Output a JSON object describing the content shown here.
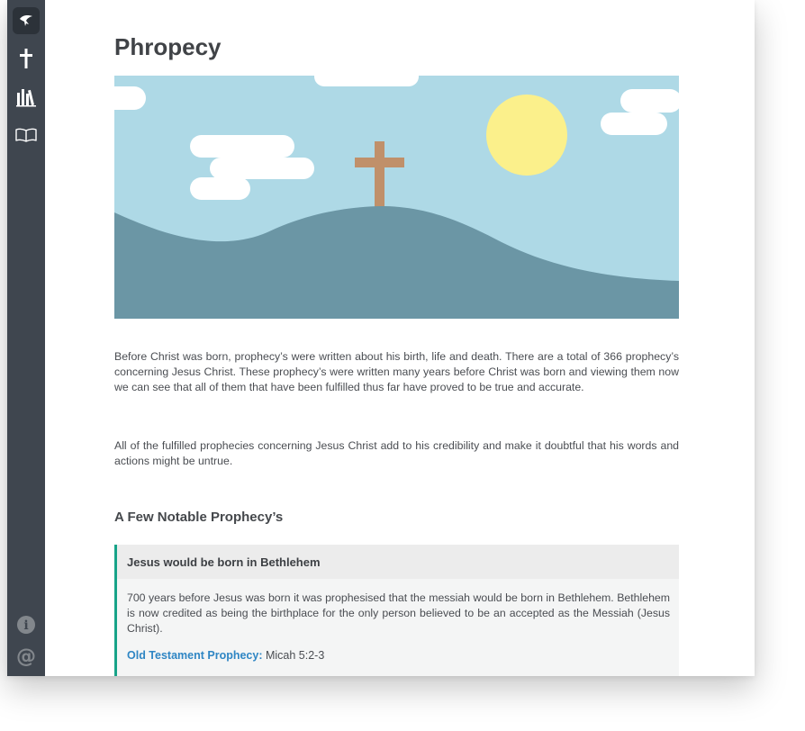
{
  "sidebar": {
    "items": [
      {
        "icon": "dove-icon",
        "active": true
      },
      {
        "icon": "cross-icon"
      },
      {
        "icon": "books-icon"
      },
      {
        "icon": "open-book-icon"
      }
    ],
    "bottom": [
      {
        "icon": "info-icon",
        "glyph": "i"
      },
      {
        "icon": "at-icon",
        "glyph": "@"
      }
    ]
  },
  "page": {
    "title": "Phropecy",
    "paragraphs": [
      "Before Christ was born, prophecy’s were written about his birth, life and death. There are a total of 366 prophecy’s concerning Jesus Christ. These prophecy’s were written many years before Christ was born and viewing them now we can see that all of them that have been fulfilled thus far have proved to be true and accurate.",
      "All of the fulfilled prophecies concerning Jesus Christ add to his credibility and make it doubtful that his words and actions might be untrue."
    ],
    "section_title": "A Few Notable Prophecy’s",
    "prophecy": {
      "title": "Jesus would be born in Bethlehem",
      "text": "700 years before Jesus was born it was prophesised that the messiah would be born in Bethlehem. Bethlehem is now credited as being the birthplace for the only person believed to be an accepted as the Messiah (Jesus Christ).",
      "ref_label": "Old Testament Prophecy:",
      "ref_value": " Micah 5:2-3"
    }
  },
  "colors": {
    "sidebar": "#3f464f",
    "sky": "#aed9e6",
    "hill": "#6b96a5",
    "sun": "#fbf08b",
    "cross": "#c0906a",
    "accent": "#17a388",
    "link": "#2f86c4"
  }
}
